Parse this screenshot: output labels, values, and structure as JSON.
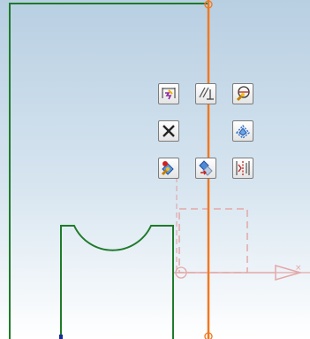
{
  "viewport": {
    "background_top": "#b8cfe2",
    "background_bottom": "#ffffff"
  },
  "sketch": {
    "profile_color": "#1f7a2a",
    "axis_color": "#f07820",
    "construction_color": "#e0a0a0"
  },
  "toolbar": {
    "buttons": [
      {
        "name": "quick-trim-icon"
      },
      {
        "name": "constraint-icon"
      },
      {
        "name": "lock-icon"
      },
      {
        "name": "delete-icon"
      },
      {
        "name": "offset-icon"
      },
      {
        "name": "edit-icon"
      },
      {
        "name": "transform-icon"
      },
      {
        "name": "mirror-icon"
      }
    ]
  }
}
